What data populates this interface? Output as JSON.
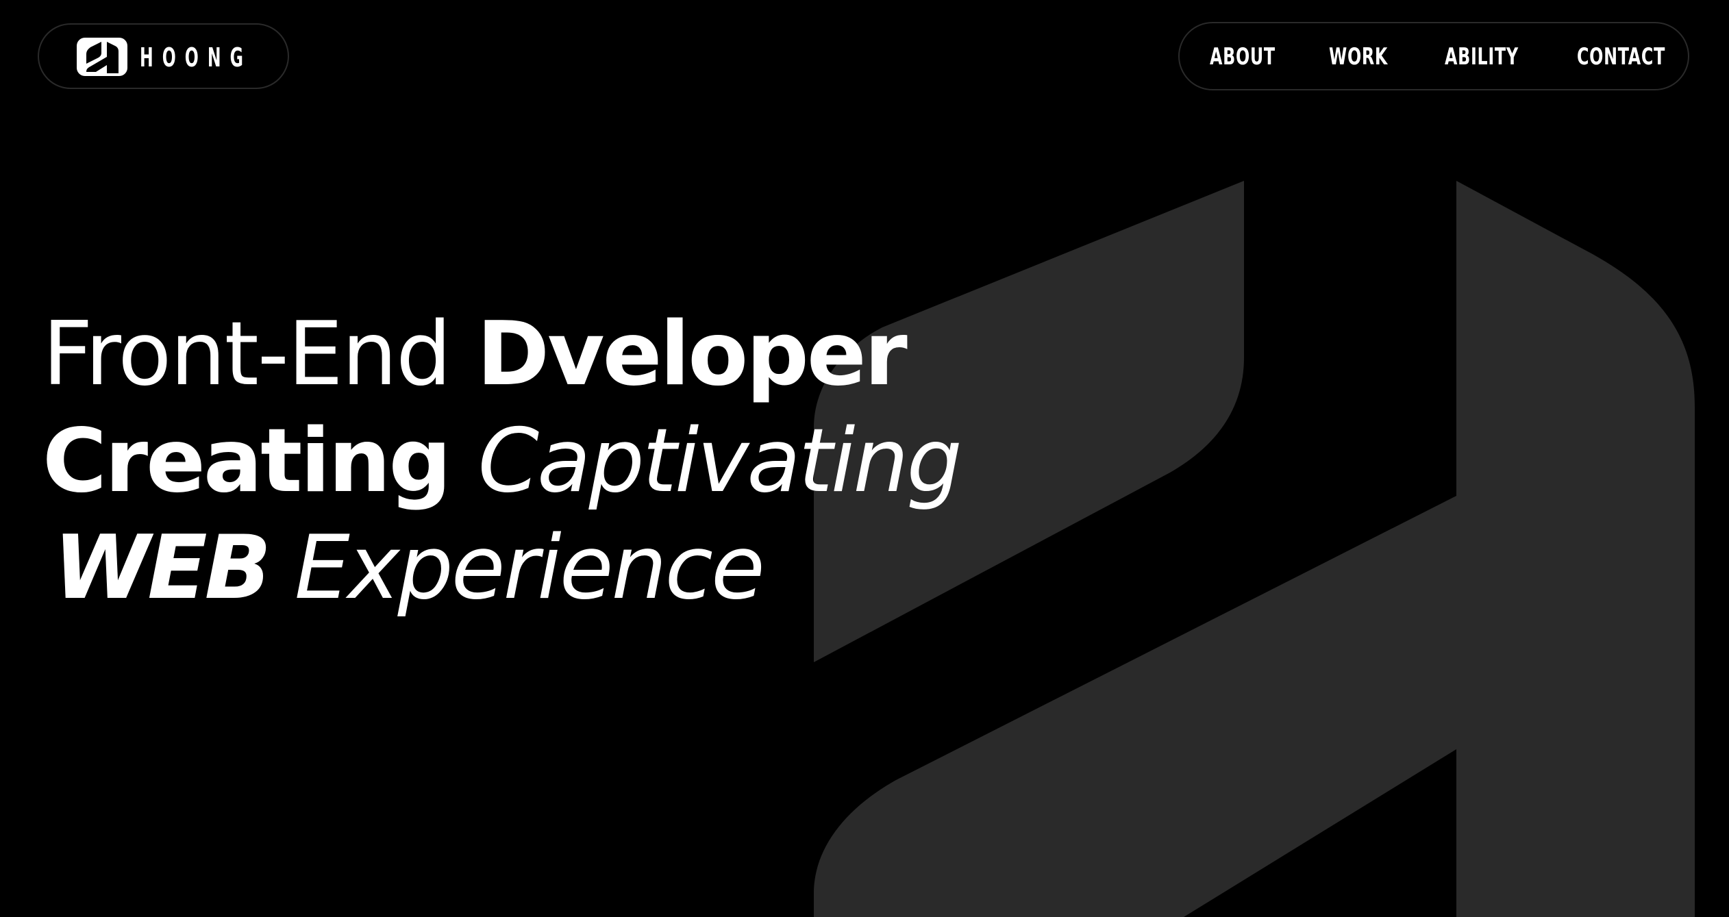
{
  "header": {
    "logo_text": "HOONG",
    "nav": [
      {
        "label": "ABOUT"
      },
      {
        "label": "WORK"
      },
      {
        "label": "ABILITY"
      },
      {
        "label": "CONTACT"
      }
    ]
  },
  "hero": {
    "line1": {
      "part1": "Front-End ",
      "part2": "Dveloper"
    },
    "line2": {
      "part1": "Creating ",
      "part2": "Captivating"
    },
    "line3": {
      "part1": "WEB",
      "part2": " Experience"
    }
  },
  "colors": {
    "background": "#000000",
    "text": "#ffffff",
    "mark": "#2a2a2a",
    "pill_border": "#2a2a2a"
  },
  "icons": {
    "logo": "hoong-logo-icon",
    "background_mark": "hoong-h-mark"
  }
}
